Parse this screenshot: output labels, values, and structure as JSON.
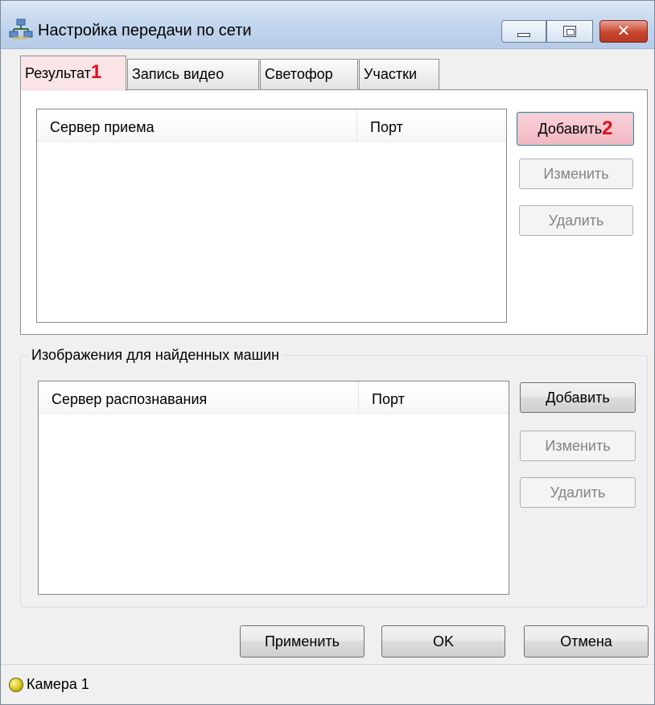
{
  "window": {
    "title": "Настройка передачи по сети",
    "icon": "network-icon",
    "controls": {
      "minimize": "minimize-icon",
      "maximize": "maximize-icon",
      "close": "close-icon"
    },
    "close_glyph": "✕"
  },
  "tabs": [
    {
      "label": "Результат",
      "badge": "1",
      "active": true
    },
    {
      "label": "Запись видео"
    },
    {
      "label": "Светофор"
    },
    {
      "label": "Участки"
    }
  ],
  "results_panel": {
    "columns": [
      "Сервер приема",
      "Порт"
    ],
    "rows": [],
    "buttons": {
      "add": "Добавить",
      "add_badge": "2",
      "edit": "Изменить",
      "delete": "Удалить"
    }
  },
  "images_group": {
    "label": "Изображения для найденных машин",
    "columns": [
      "Сервер распознавания",
      "Порт"
    ],
    "rows": [],
    "buttons": {
      "add": "Добавить",
      "edit": "Изменить",
      "delete": "Удалить"
    }
  },
  "footer": {
    "apply": "Применить",
    "ok": "OK",
    "cancel": "Отмена"
  },
  "statusbar": {
    "text": "Камера 1",
    "icon": "camera-status-icon"
  },
  "colors": {
    "highlight_badge": "#e0101b",
    "highlight_bg": "#fbe4e8",
    "titlebar": "#c3d6ee",
    "close_button": "#c9462f"
  }
}
